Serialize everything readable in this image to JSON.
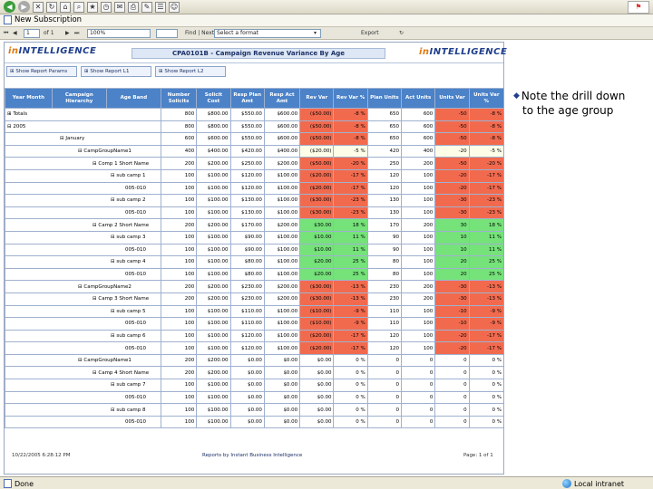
{
  "browser": {
    "tab_title": "New Subscription",
    "status_left": "Done",
    "status_right": "Local intranet"
  },
  "report_toolbar": {
    "page_of": "of 1",
    "page_current": "1",
    "zoom": "100%",
    "find_next": "Find | Next",
    "format_select": "Select a format",
    "export": "Export"
  },
  "report": {
    "logo_left": "INTELLIGENCE",
    "logo_left_lead": "in",
    "logo_right": "INTELLIGENCE",
    "logo_right_lead": "in",
    "title": "CPA0101B - Campaign Revenue Variance By Age",
    "tabs": [
      "⊞ Show Report Params",
      "⊞ Show Report L1",
      "⊞ Show Report L2"
    ],
    "columns": [
      "Year Month",
      "Campaign Hierarchy",
      "Age Band",
      "Number Solicits",
      "Solicit Cost",
      "Resp Plan Amt",
      "Resp Act Amt",
      "Rev Var",
      "Rev Var %",
      "Plan Units",
      "Act Units",
      "Units Var",
      "Units Var %"
    ],
    "rows": [
      {
        "label": "⊞ Totals",
        "indent": 0,
        "col": 0,
        "vals": [
          "800",
          "$800.00",
          "$550.00",
          "$600.00",
          "($50.00)",
          "-8 %",
          "650",
          "600",
          "-50",
          "-8 %"
        ],
        "tone": "neg"
      },
      {
        "label": "⊟ 2005",
        "indent": 0,
        "col": 0,
        "vals": [
          "800",
          "$800.00",
          "$550.00",
          "$600.00",
          "($50.00)",
          "-8 %",
          "650",
          "600",
          "-50",
          "-8 %"
        ],
        "tone": "neg"
      },
      {
        "label": "⊟ January",
        "indent": 22,
        "col": 1,
        "vals": [
          "600",
          "$600.00",
          "$550.00",
          "$600.00",
          "($50.00)",
          "-8 %",
          "650",
          "600",
          "-50",
          "-8 %"
        ],
        "tone": "neg"
      },
      {
        "label": "⊟ CampGroupName1",
        "indent": 42,
        "col": 1,
        "vals": [
          "400",
          "$400.00",
          "$420.00",
          "$400.00",
          "($20.00)",
          "-5 %",
          "420",
          "400",
          "-20",
          "-5 %"
        ],
        "tone": "neu"
      },
      {
        "label": "⊟ Comp 1 Short Name",
        "indent": 58,
        "col": 1,
        "vals": [
          "200",
          "$200.00",
          "$250.00",
          "$200.00",
          "($50.00)",
          "-20 %",
          "250",
          "200",
          "-50",
          "-20 %"
        ],
        "tone": "neg"
      },
      {
        "label": "⊟ sub camp 1",
        "indent": 78,
        "col": 1,
        "vals": [
          "100",
          "$100.00",
          "$120.00",
          "$100.00",
          "($20.00)",
          "-17 %",
          "120",
          "100",
          "-20",
          "-17 %"
        ],
        "tone": "neg"
      },
      {
        "label": "005-010",
        "indent": 0,
        "col": 2,
        "vals": [
          "100",
          "$100.00",
          "$120.00",
          "$100.00",
          "($20.00)",
          "-17 %",
          "120",
          "100",
          "-20",
          "-17 %"
        ],
        "tone": "neg"
      },
      {
        "label": "⊟ sub camp 2",
        "indent": 78,
        "col": 1,
        "vals": [
          "100",
          "$100.00",
          "$130.00",
          "$100.00",
          "($30.00)",
          "-23 %",
          "130",
          "100",
          "-30",
          "-23 %"
        ],
        "tone": "neg"
      },
      {
        "label": "005-010",
        "indent": 0,
        "col": 2,
        "vals": [
          "100",
          "$100.00",
          "$130.00",
          "$100.00",
          "($30.00)",
          "-23 %",
          "130",
          "100",
          "-30",
          "-23 %"
        ],
        "tone": "neg"
      },
      {
        "label": "⊟ Camp 2 Short Name",
        "indent": 58,
        "col": 1,
        "vals": [
          "200",
          "$200.00",
          "$170.00",
          "$200.00",
          "$30.00",
          "18 %",
          "170",
          "200",
          "30",
          "18 %"
        ],
        "tone": "pos"
      },
      {
        "label": "⊟ sub camp 3",
        "indent": 78,
        "col": 1,
        "vals": [
          "100",
          "$100.00",
          "$90.00",
          "$100.00",
          "$10.00",
          "11 %",
          "90",
          "100",
          "10",
          "11 %"
        ],
        "tone": "pos"
      },
      {
        "label": "005-010",
        "indent": 0,
        "col": 2,
        "vals": [
          "100",
          "$100.00",
          "$90.00",
          "$100.00",
          "$10.00",
          "11 %",
          "90",
          "100",
          "10",
          "11 %"
        ],
        "tone": "pos"
      },
      {
        "label": "⊟ sub camp 4",
        "indent": 78,
        "col": 1,
        "vals": [
          "100",
          "$100.00",
          "$80.00",
          "$100.00",
          "$20.00",
          "25 %",
          "80",
          "100",
          "20",
          "25 %"
        ],
        "tone": "pos"
      },
      {
        "label": "005-010",
        "indent": 0,
        "col": 2,
        "vals": [
          "100",
          "$100.00",
          "$80.00",
          "$100.00",
          "$20.00",
          "25 %",
          "80",
          "100",
          "20",
          "25 %"
        ],
        "tone": "pos"
      },
      {
        "label": "⊟ CampGroupName2",
        "indent": 42,
        "col": 1,
        "vals": [
          "200",
          "$200.00",
          "$230.00",
          "$200.00",
          "($30.00)",
          "-13 %",
          "230",
          "200",
          "-30",
          "-13 %"
        ],
        "tone": "neg"
      },
      {
        "label": "⊟ Camp 3 Short Name",
        "indent": 58,
        "col": 1,
        "vals": [
          "200",
          "$200.00",
          "$230.00",
          "$200.00",
          "($30.00)",
          "-13 %",
          "230",
          "200",
          "-30",
          "-13 %"
        ],
        "tone": "neg"
      },
      {
        "label": "⊟ sub camp 5",
        "indent": 78,
        "col": 1,
        "vals": [
          "100",
          "$100.00",
          "$110.00",
          "$100.00",
          "($10.00)",
          "-9 %",
          "110",
          "100",
          "-10",
          "-9 %"
        ],
        "tone": "neg"
      },
      {
        "label": "005-010",
        "indent": 0,
        "col": 2,
        "vals": [
          "100",
          "$100.00",
          "$110.00",
          "$100.00",
          "($10.00)",
          "-9 %",
          "110",
          "100",
          "-10",
          "-9 %"
        ],
        "tone": "neg"
      },
      {
        "label": "⊟ sub camp 6",
        "indent": 78,
        "col": 1,
        "vals": [
          "100",
          "$100.00",
          "$120.00",
          "$100.00",
          "($20.00)",
          "-17 %",
          "120",
          "100",
          "-20",
          "-17 %"
        ],
        "tone": "neg"
      },
      {
        "label": "005-010",
        "indent": 0,
        "col": 2,
        "vals": [
          "100",
          "$100.00",
          "$120.00",
          "$100.00",
          "($20.00)",
          "-17 %",
          "120",
          "100",
          "-20",
          "-17 %"
        ],
        "tone": "neg"
      },
      {
        "label": "⊟ CampGroupName1",
        "indent": 42,
        "col": 1,
        "vals": [
          "200",
          "$200.00",
          "$0.00",
          "$0.00",
          "$0.00",
          "0 %",
          "0",
          "0",
          "0",
          "0 %"
        ],
        "tone": "none"
      },
      {
        "label": "⊟ Camp 4 Short Name",
        "indent": 58,
        "col": 1,
        "vals": [
          "200",
          "$200.00",
          "$0.00",
          "$0.00",
          "$0.00",
          "0 %",
          "0",
          "0",
          "0",
          "0 %"
        ],
        "tone": "none"
      },
      {
        "label": "⊟ sub camp 7",
        "indent": 78,
        "col": 1,
        "vals": [
          "100",
          "$100.00",
          "$0.00",
          "$0.00",
          "$0.00",
          "0 %",
          "0",
          "0",
          "0",
          "0 %"
        ],
        "tone": "none"
      },
      {
        "label": "005-010",
        "indent": 0,
        "col": 2,
        "vals": [
          "100",
          "$100.00",
          "$0.00",
          "$0.00",
          "$0.00",
          "0 %",
          "0",
          "0",
          "0",
          "0 %"
        ],
        "tone": "none"
      },
      {
        "label": "⊟ sub camp 8",
        "indent": 78,
        "col": 1,
        "vals": [
          "100",
          "$100.00",
          "$0.00",
          "$0.00",
          "$0.00",
          "0 %",
          "0",
          "0",
          "0",
          "0 %"
        ],
        "tone": "none"
      },
      {
        "label": "005-010",
        "indent": 0,
        "col": 2,
        "vals": [
          "100",
          "$100.00",
          "$0.00",
          "$0.00",
          "$0.00",
          "0 %",
          "0",
          "0",
          "0",
          "0 %"
        ],
        "tone": "none"
      }
    ],
    "footer_date": "10/22/2005 6:28:12 PM",
    "footer_mid": "Reports by Instant Business Intelligence",
    "footer_page": "Page: 1 of 1",
    "colors": {
      "header": "#4b82c8",
      "negative": "#f26a4e",
      "positive": "#75e27a",
      "neutral": "#fdfde8"
    }
  },
  "annotation": {
    "line1": "Note the drill down",
    "line2": "to the age group"
  }
}
